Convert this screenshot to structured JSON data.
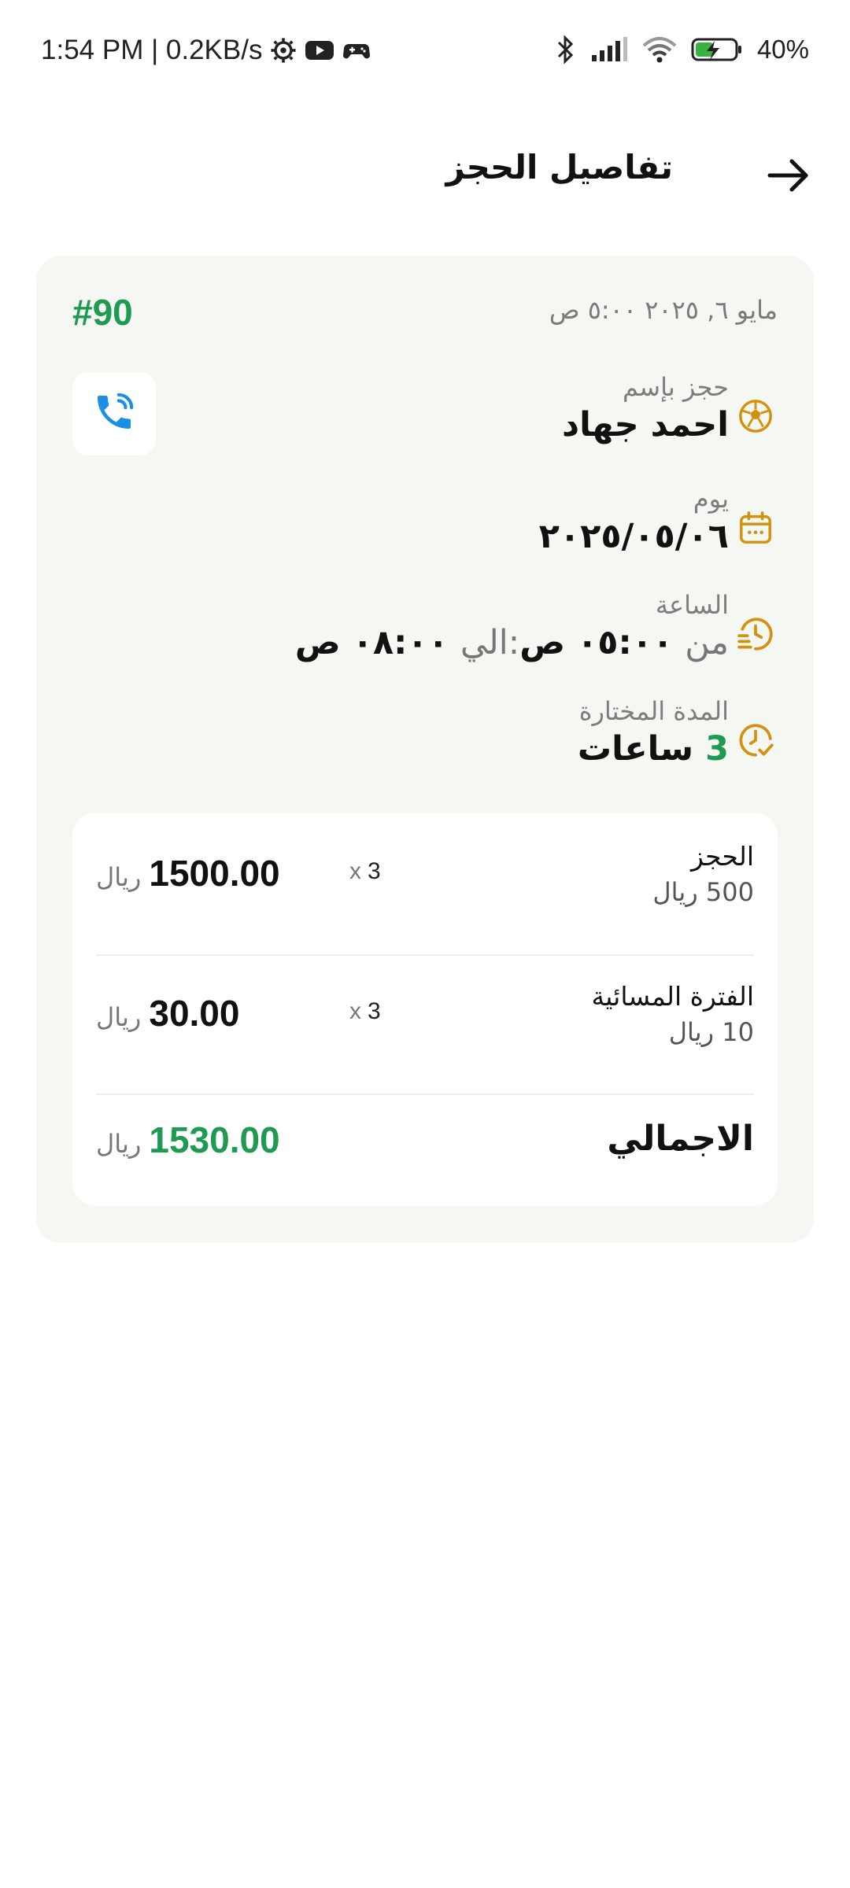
{
  "status_bar": {
    "time_speed": "1:54 PM | 0.2KB/s",
    "battery": "40%"
  },
  "header": {
    "title": "تفاصيل الحجز"
  },
  "booking": {
    "number": "#90",
    "created_at": "مايو ٦, ٢٠٢٥ ٥:٠٠ ص",
    "name_label": "حجز بإسم",
    "name": "احمد جهاد",
    "day_label": "يوم",
    "day": "٢٠٢٥/٠٥/٠٦",
    "time_label": "الساعة",
    "time_from_word": "من",
    "time_from": "٠٥:٠٠ ص",
    "time_to_word": ":الي",
    "time_to": "٠٨:٠٠ ص",
    "duration_label": "المدة المختارة",
    "duration_number": "3",
    "duration_unit": "ساعات"
  },
  "pricing": {
    "currency": "ريال",
    "lines": [
      {
        "name": "الحجز",
        "unit_price": "500 ريال",
        "qty_x": "x",
        "qty": "3",
        "amount": "1500.00"
      },
      {
        "name": "الفترة المسائية",
        "unit_price": "10 ريال",
        "qty_x": "x",
        "qty": "3",
        "amount": "30.00"
      }
    ],
    "total_label": "الاجمالي",
    "total": "1530.00"
  },
  "colors": {
    "accent_green": "#1f9a52",
    "icon_orange": "#d4900f",
    "phone_blue": "#1a8fe3"
  }
}
